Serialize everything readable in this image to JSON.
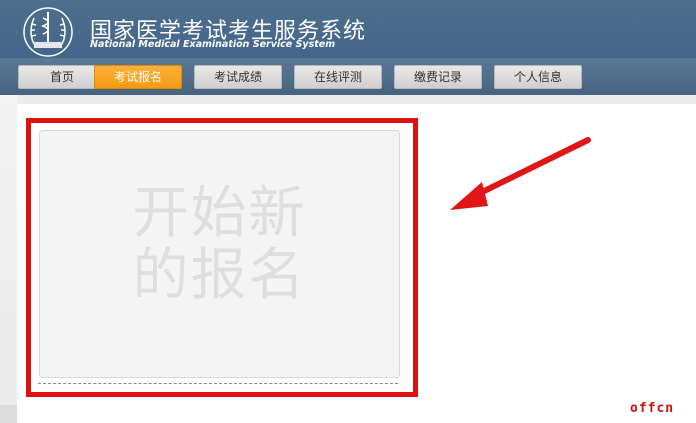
{
  "header": {
    "title": "国家医学考试考生服务系统",
    "subtitle": "National Medical Examination Service System"
  },
  "nav": {
    "items": [
      {
        "label": "首页",
        "active": false
      },
      {
        "label": "考试报名",
        "active": true
      },
      {
        "label": "考试成绩",
        "active": false
      },
      {
        "label": "在线评测",
        "active": false
      },
      {
        "label": "缴费记录",
        "active": false
      },
      {
        "label": "个人信息",
        "active": false
      }
    ]
  },
  "main": {
    "new_registration_line1": "开始新",
    "new_registration_line2": "的报名"
  },
  "watermark": "offcn",
  "colors": {
    "header_bg": "#46678a",
    "nav_active": "#f7a21b",
    "highlight": "#dd1111"
  }
}
